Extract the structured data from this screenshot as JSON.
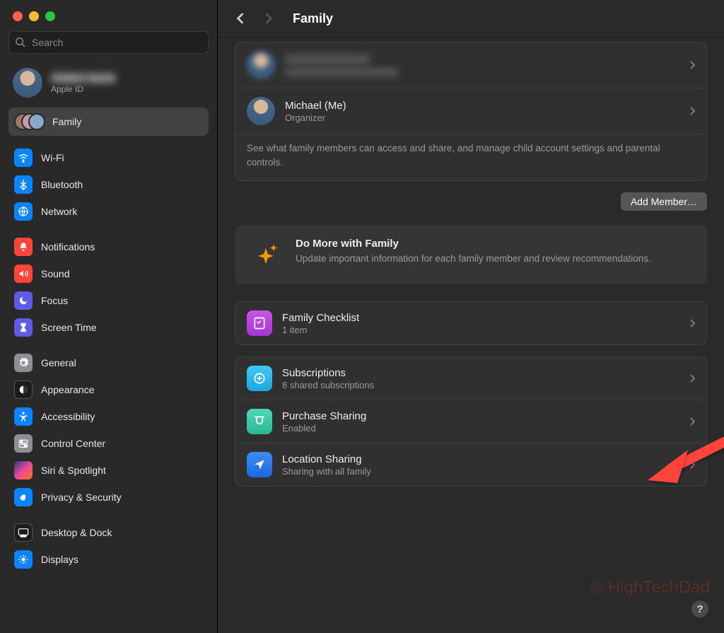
{
  "search": {
    "placeholder": "Search"
  },
  "profile": {
    "name_hidden": "Hidden Name",
    "sub": "Apple ID"
  },
  "sidebar": {
    "family_label": "Family",
    "items": [
      {
        "label": "Wi-Fi",
        "icon": "wifi-icon",
        "color": "i-wifi"
      },
      {
        "label": "Bluetooth",
        "icon": "bluetooth-icon",
        "color": "i-bt"
      },
      {
        "label": "Network",
        "icon": "network-icon",
        "color": "i-net"
      }
    ],
    "items2": [
      {
        "label": "Notifications",
        "icon": "bell-icon",
        "color": "i-notif"
      },
      {
        "label": "Sound",
        "icon": "speaker-icon",
        "color": "i-sound"
      },
      {
        "label": "Focus",
        "icon": "moon-icon",
        "color": "i-focus"
      },
      {
        "label": "Screen Time",
        "icon": "hourglass-icon",
        "color": "i-screen"
      }
    ],
    "items3": [
      {
        "label": "General",
        "icon": "gear-icon",
        "color": "i-general"
      },
      {
        "label": "Appearance",
        "icon": "appearance-icon",
        "color": "i-appear"
      },
      {
        "label": "Accessibility",
        "icon": "accessibility-icon",
        "color": "i-access"
      },
      {
        "label": "Control Center",
        "icon": "control-center-icon",
        "color": "i-control"
      },
      {
        "label": "Siri & Spotlight",
        "icon": "siri-icon",
        "color": "i-siri"
      },
      {
        "label": "Privacy & Security",
        "icon": "hand-icon",
        "color": "i-privacy"
      }
    ],
    "items4": [
      {
        "label": "Desktop & Dock",
        "icon": "desktop-icon",
        "color": "i-desktop"
      },
      {
        "label": "Displays",
        "icon": "displays-icon",
        "color": "i-displays"
      }
    ]
  },
  "toolbar": {
    "title": "Family"
  },
  "members": {
    "row0_name": "Hidden",
    "row0_sub": "Hidden",
    "row1_name": "Michael (Me)",
    "row1_sub": "Organizer",
    "description": "See what family members can access and share, and manage child account settings and parental controls."
  },
  "add_member": "Add Member…",
  "promo": {
    "title": "Do More with Family",
    "sub": "Update important information for each family member and review recommendations."
  },
  "checklist": {
    "title": "Family Checklist",
    "sub": "1 item"
  },
  "subscriptions": {
    "title": "Subscriptions",
    "sub": "8 shared subscriptions"
  },
  "purchase": {
    "title": "Purchase Sharing",
    "sub": "Enabled"
  },
  "location": {
    "title": "Location Sharing",
    "sub": "Sharing with all family"
  },
  "watermark": "© HighTechDad",
  "help": "?"
}
